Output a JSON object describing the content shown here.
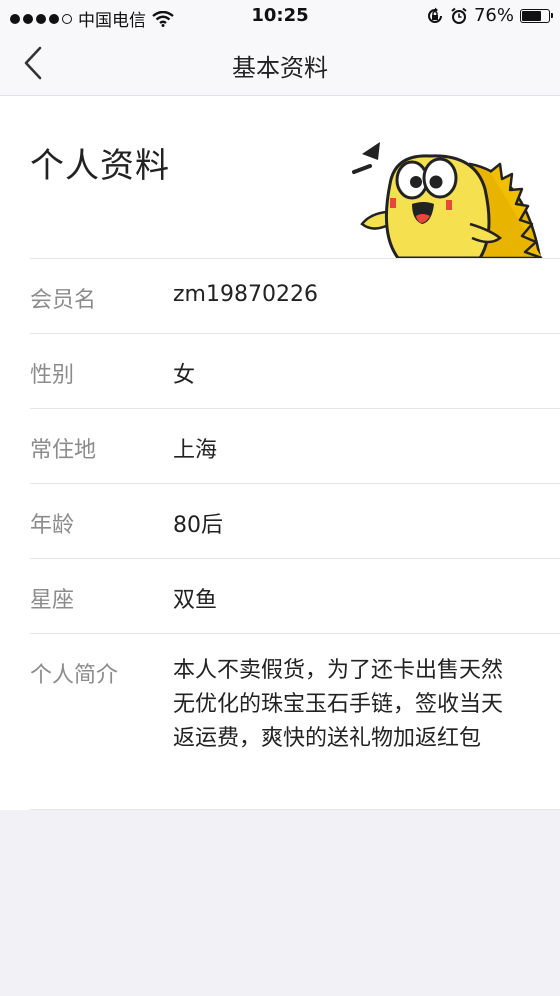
{
  "status_bar": {
    "carrier": "中国电信",
    "time": "10:25",
    "battery": "76%",
    "battery_level": 0.76,
    "signal_bars_filled": 4,
    "signal_bars_total": 5
  },
  "nav": {
    "title": "基本资料"
  },
  "profile": {
    "header": "个人资料",
    "rows": [
      {
        "label": "会员名",
        "value": "zm19870226"
      },
      {
        "label": "性别",
        "value": "女"
      },
      {
        "label": "常住地",
        "value": "上海"
      },
      {
        "label": "年龄",
        "value": "80后"
      },
      {
        "label": "星座",
        "value": "双鱼"
      },
      {
        "label": "个人简介",
        "value": "本人不卖假货，为了还卡出售天然无优化的珠宝玉石手链，签收当天返运费，爽快的送礼物加返红包"
      }
    ]
  },
  "colors": {
    "accent": "#f5c518",
    "background": "#f2f2f6",
    "label": "#8c8c8c"
  }
}
